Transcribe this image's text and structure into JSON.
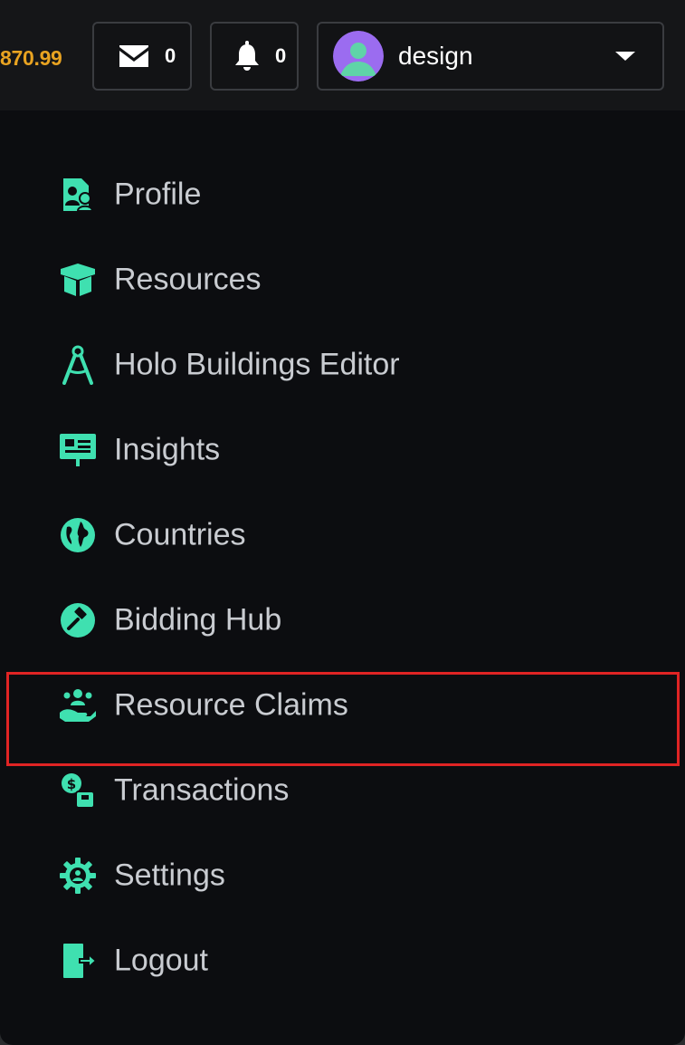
{
  "header": {
    "balance": "870.99",
    "mail_count": "0",
    "notification_count": "0",
    "username": "design",
    "icons": {
      "mail": "envelope-icon",
      "notifications": "bell-icon",
      "dropdown": "caret-down-icon"
    }
  },
  "colors": {
    "accent": "#3fe0b0",
    "balance": "#e8a321",
    "menu_text": "#c9ccd1",
    "background": "#0c0d10",
    "highlight_border": "#e02424",
    "avatar_bg": "#9b6cf0"
  },
  "menu": {
    "items": [
      {
        "label": "Profile",
        "icon": "profile-icon"
      },
      {
        "label": "Resources",
        "icon": "box-icon"
      },
      {
        "label": "Holo Buildings Editor",
        "icon": "compass-icon"
      },
      {
        "label": "Insights",
        "icon": "presentation-icon"
      },
      {
        "label": "Countries",
        "icon": "globe-icon"
      },
      {
        "label": "Bidding Hub",
        "icon": "gavel-icon"
      },
      {
        "label": "Resource Claims",
        "icon": "hand-users-icon"
      },
      {
        "label": "Transactions",
        "icon": "exchange-icon"
      },
      {
        "label": "Settings",
        "icon": "gear-icon"
      },
      {
        "label": "Logout",
        "icon": "logout-icon"
      }
    ]
  }
}
